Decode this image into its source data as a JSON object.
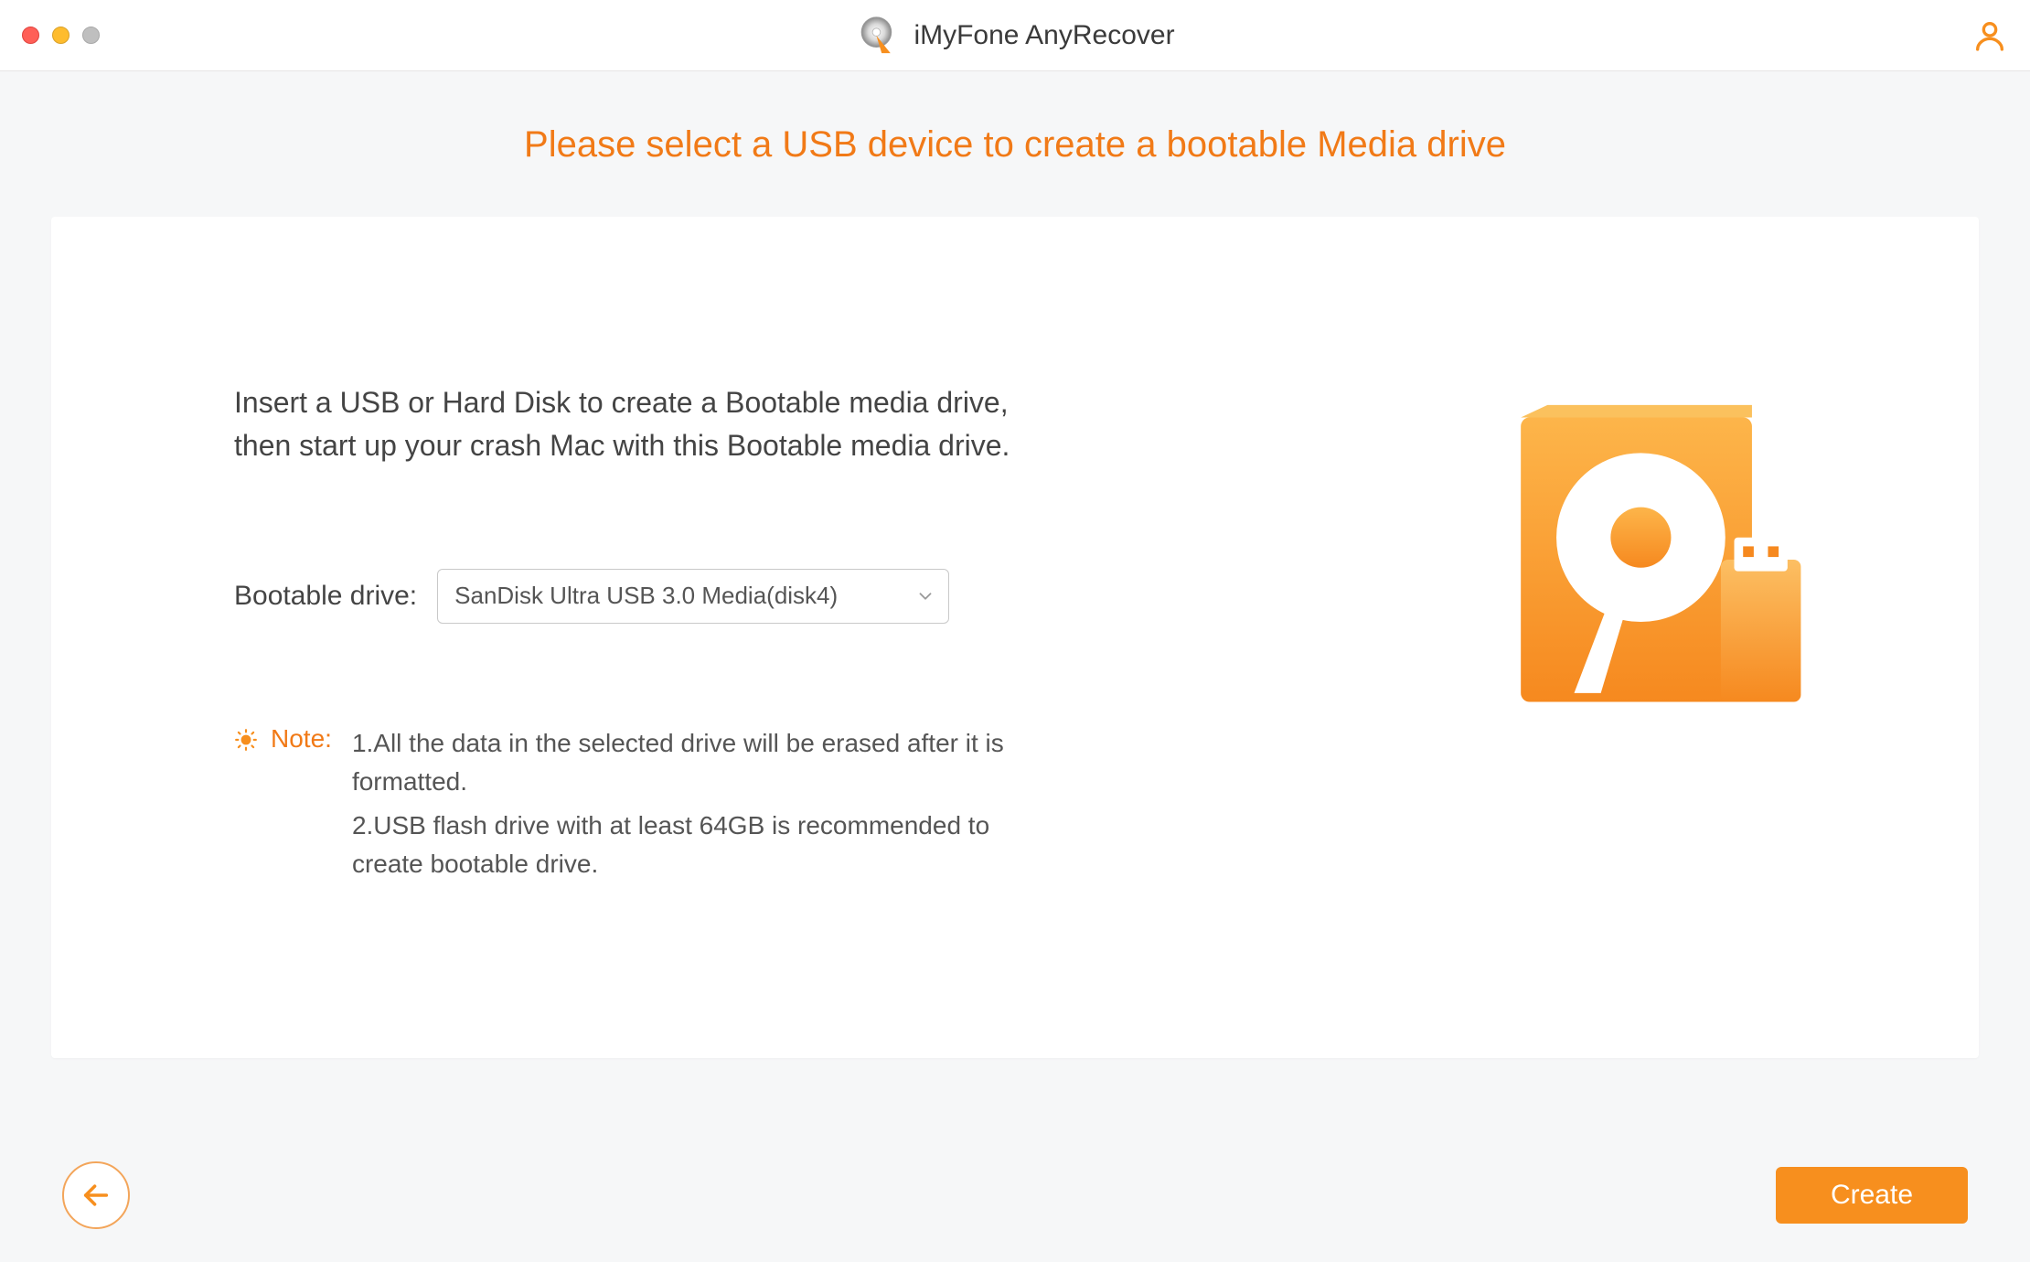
{
  "app": {
    "title": "iMyFone AnyRecover"
  },
  "page": {
    "heading": "Please select a USB device to create a bootable Media drive",
    "instruction_l1": "Insert a USB or Hard Disk to create a Bootable media drive,",
    "instruction_l2": "then start up your crash Mac with this Bootable media drive."
  },
  "drive": {
    "label": "Bootable drive:",
    "selected": "SanDisk Ultra USB 3.0 Media(disk4)"
  },
  "note": {
    "label": "Note:",
    "line1": "1.All the data in the selected drive will be erased after it is formatted.",
    "line2": "2.USB flash drive with at least 64GB is recommended to create bootable drive."
  },
  "footer": {
    "create_label": "Create"
  },
  "colors": {
    "accent": "#f78f1e",
    "heading": "#f17a17"
  }
}
